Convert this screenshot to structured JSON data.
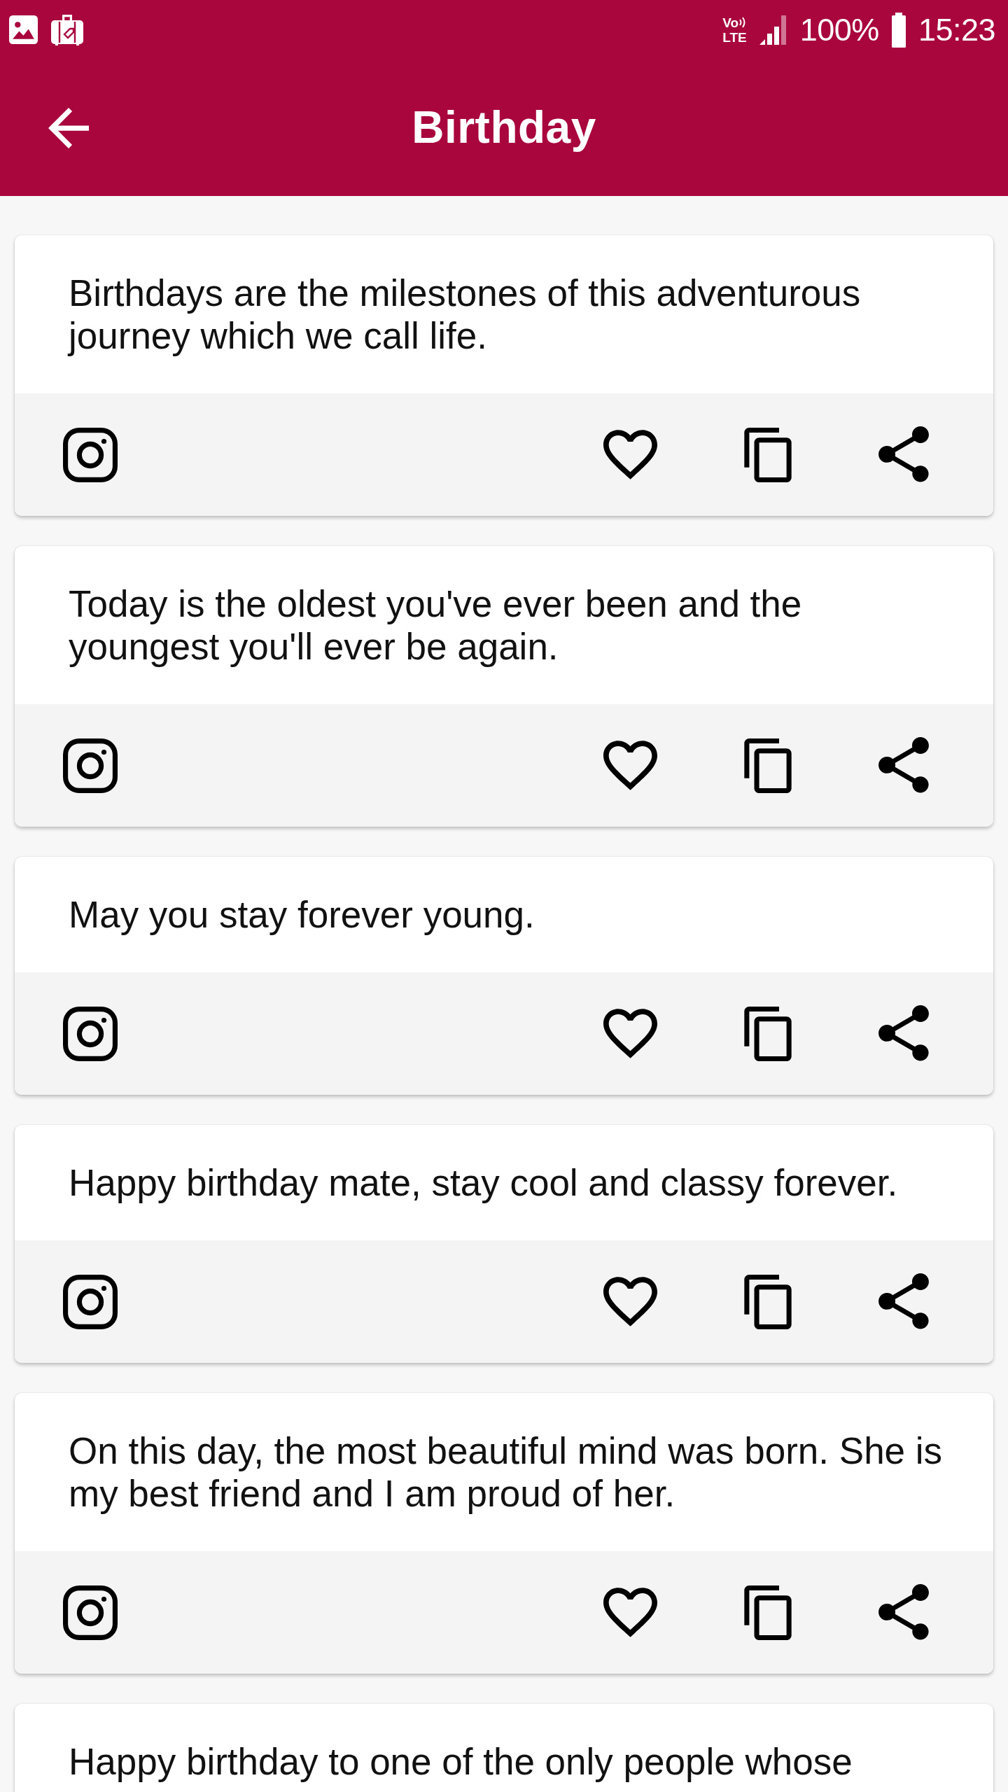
{
  "status_bar": {
    "network": {
      "top": "Vo",
      "bottom": "LTE"
    },
    "battery": "100%",
    "time": "15:23"
  },
  "app_bar": {
    "title": "Birthday"
  },
  "quotes": [
    {
      "text": "Birthdays are the milestones of this adventurous journey which we call life.",
      "actions": {
        "favorite": false
      }
    },
    {
      "text": "Today is the oldest you've ever been and the youngest you'll ever be again.",
      "actions": {
        "favorite": false
      }
    },
    {
      "text": "May you stay forever young.",
      "actions": {
        "favorite": false
      }
    },
    {
      "text": "Happy birthday mate, stay cool and classy forever.",
      "actions": {
        "favorite": false
      }
    },
    {
      "text": "On this day, the most beautiful mind was born. She is my best friend and I am proud of her.",
      "actions": {
        "favorite": false
      }
    },
    {
      "text": "Happy birthday to one of the only people whose"
    }
  ]
}
